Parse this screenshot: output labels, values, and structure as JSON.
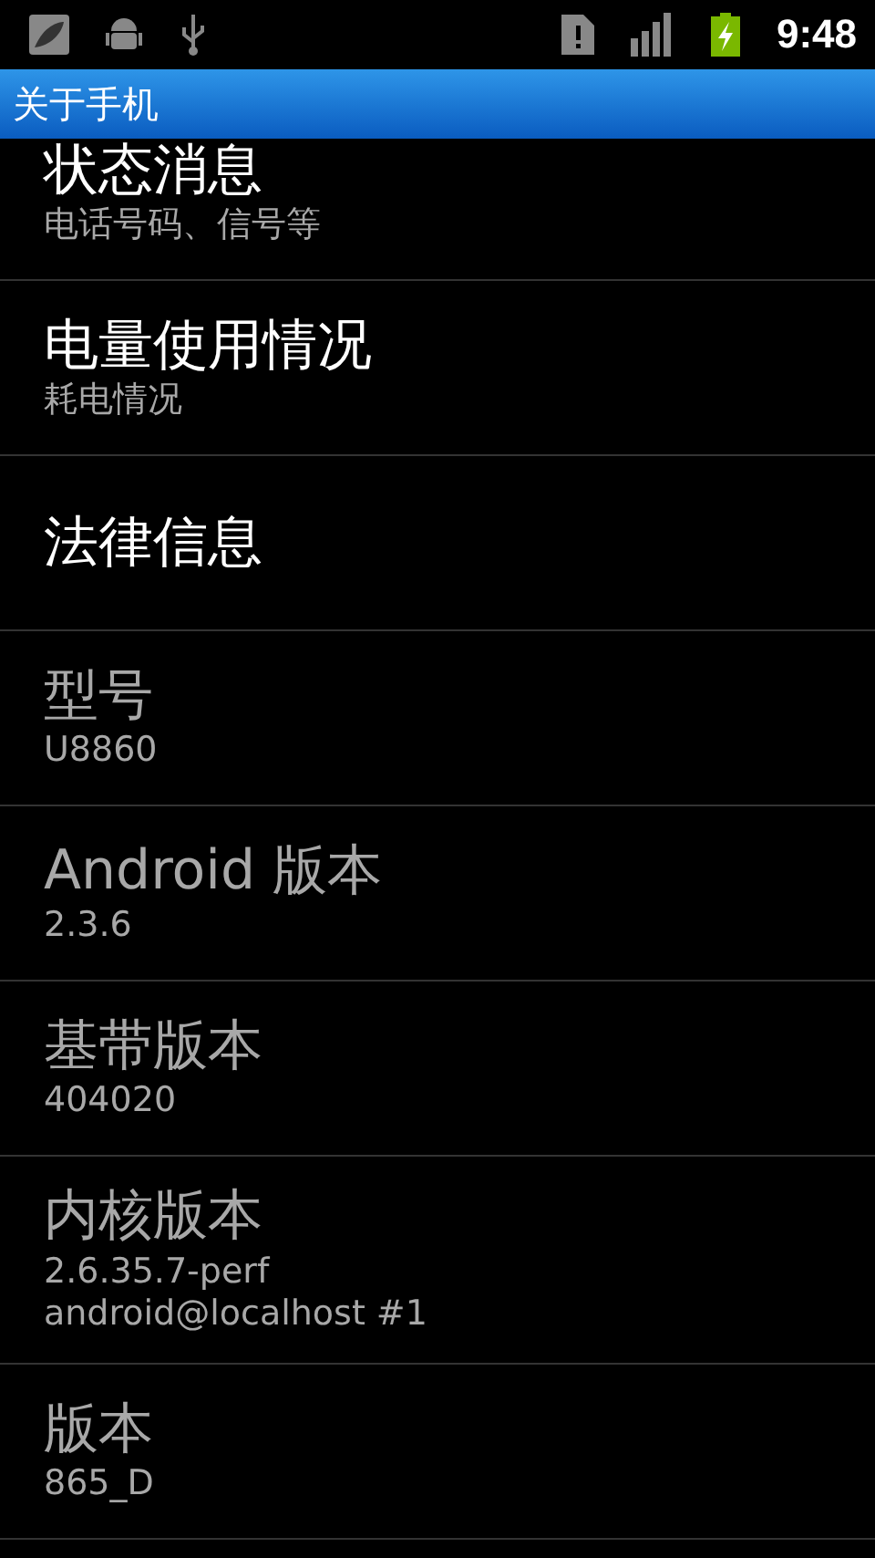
{
  "status_bar": {
    "time": "9:48"
  },
  "title_bar": {
    "title": "关于手机"
  },
  "items": [
    {
      "title": "状态消息",
      "summary": "电话号码、信号等",
      "disabled": false
    },
    {
      "title": "电量使用情况",
      "summary": "耗电情况",
      "disabled": false
    },
    {
      "title": "法律信息",
      "disabled": false
    },
    {
      "title": "型号",
      "summary": "U8860",
      "disabled": true
    },
    {
      "title": "Android 版本",
      "summary": "2.3.6",
      "disabled": true
    },
    {
      "title": "基带版本",
      "summary": "404020",
      "disabled": true
    },
    {
      "title": "内核版本",
      "summary": "2.6.35.7-perf\nandroid@localhost #1",
      "disabled": true
    },
    {
      "title": "版本",
      "summary": "865_D",
      "disabled": true
    }
  ]
}
